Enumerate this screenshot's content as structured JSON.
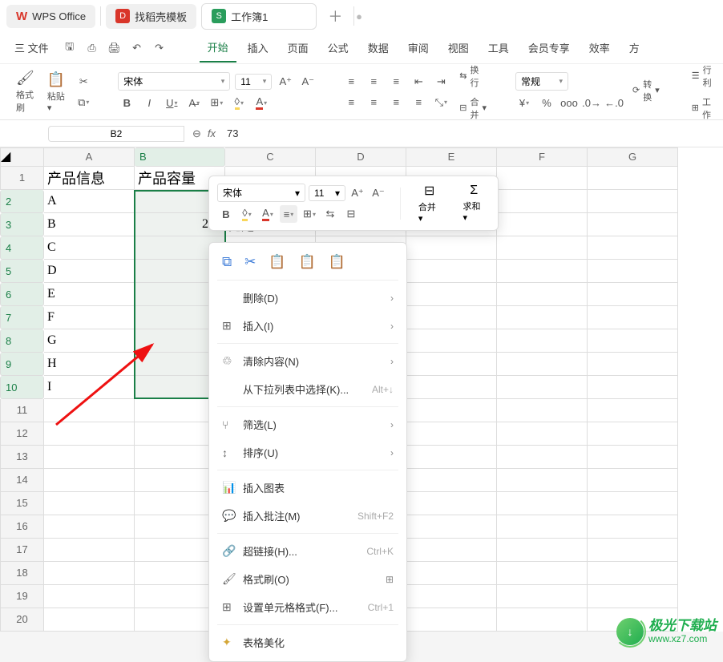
{
  "tabs": {
    "office": "WPS Office",
    "tpl": "找稻壳模板",
    "book": "工作簿1"
  },
  "menubar": {
    "file": "三 文件",
    "items": [
      "开始",
      "插入",
      "页面",
      "公式",
      "数据",
      "审阅",
      "视图",
      "工具",
      "会员专享",
      "效率",
      "方"
    ]
  },
  "ribbon": {
    "format_brush": "格式刷",
    "paste": "粘贴",
    "font_name": "宋体",
    "font_size": "11",
    "wrap": "换行",
    "merge": "合并",
    "general": "常规",
    "convert": "转换",
    "rowcol": "行利",
    "worksheet": "工作",
    "bold": "B",
    "italic": "I",
    "underline": "U"
  },
  "namebox": {
    "ref": "B2",
    "fx_value": "73"
  },
  "columns": [
    "A",
    "B",
    "C",
    "D",
    "E",
    "F",
    "G"
  ],
  "rows": [
    "1",
    "2",
    "3",
    "4",
    "5",
    "6",
    "7",
    "8",
    "9",
    "10",
    "11",
    "12",
    "13",
    "14",
    "15",
    "16",
    "17",
    "18",
    "19",
    "20"
  ],
  "cells": {
    "A1": "产品信息",
    "B1": "产品容量",
    "A2": "A",
    "A3": "B",
    "A4": "C",
    "A5": "D",
    "A6": "E",
    "A7": "F",
    "A8": "G",
    "A9": "H",
    "A10": "I",
    "B3": "288",
    "C3": "充足"
  },
  "mini": {
    "font": "宋体",
    "size": "11",
    "bold": "B",
    "merge": "合并",
    "sum": "求和"
  },
  "ctx": {
    "delete": "删除(D)",
    "insert": "插入(I)",
    "clear": "清除内容(N)",
    "fromlist": "从下拉列表中选择(K)...",
    "fromlist_sc": "Alt+↓",
    "filter": "筛选(L)",
    "sort": "排序(U)",
    "chart": "插入图表",
    "comment": "插入批注(M)",
    "comment_sc": "Shift+F2",
    "link": "超链接(H)...",
    "link_sc": "Ctrl+K",
    "brush": "格式刷(O)",
    "fmt": "设置单元格格式(F)...",
    "fmt_sc": "Ctrl+1",
    "beautify": "表格美化"
  },
  "watermark": {
    "t1": "极光下载站",
    "t2": "www.xz7.com"
  }
}
